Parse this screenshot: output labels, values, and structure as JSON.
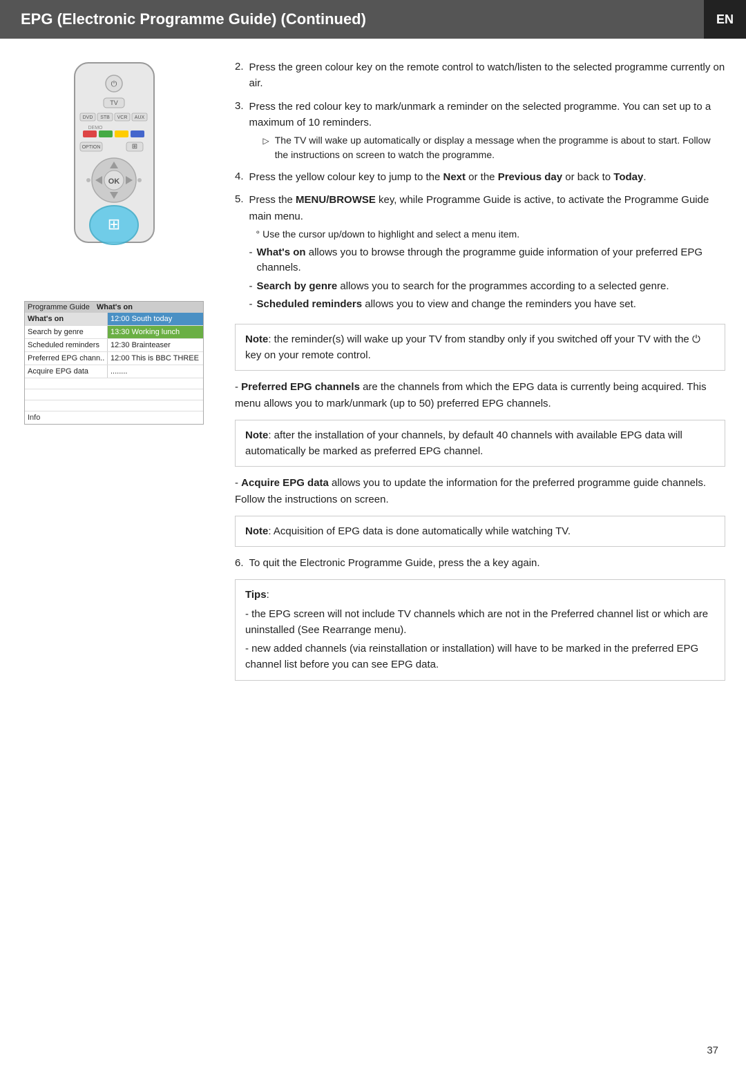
{
  "header": {
    "title": "EPG (Electronic Programme Guide) (Continued)",
    "lang": "EN"
  },
  "steps": [
    {
      "num": "2.",
      "text": "Press the green colour key on the remote control to watch/listen to the selected programme currently on air."
    },
    {
      "num": "3.",
      "text": "Press the red colour key to mark/unmark a reminder on the selected programme. You can set up to a maximum of 10 reminders.",
      "sub": "The TV will wake up automatically or display a message when the programme is about to start. Follow the instructions on screen to watch the programme."
    },
    {
      "num": "4.",
      "text_before": "Press the yellow colour key to jump to the ",
      "bold_part": "Next",
      "text_middle": " or the ",
      "bold_part2": "Previous day",
      "text_after": " or back to ",
      "bold_part3": "Today",
      "text_end": "."
    },
    {
      "num": "5.",
      "text_before": "Press the ",
      "bold_part": "MENU/BROWSE",
      "text_after": " key, while Programme Guide is active, to activate the Programme Guide main menu.",
      "degree_text": "Use the cursor up/down to highlight and select a menu item.",
      "sub_items": [
        {
          "bold": "What's on",
          "text": " allows you to browse through the programme guide information of your preferred EPG channels."
        },
        {
          "bold": "Search by genre",
          "text": " allows you to search for the programmes according to a selected genre."
        },
        {
          "bold": "Scheduled reminders",
          "text": " allows you to view and change the reminders you have set."
        }
      ]
    }
  ],
  "note1": {
    "label": "Note",
    "text": ": the reminder(s) will wake up your TV from standby only if you switched off your TV with the ",
    "text2": " key on your remote control."
  },
  "preferred_epg": {
    "bold_label": "Preferred EPG channels",
    "text": " are the channels from which the EPG data is currently being  acquired. This menu allows you to mark/unmark (up to 50) preferred EPG channels."
  },
  "note2": {
    "label": "Note",
    "text": ": after the installation of your channels, by default 40 channels with available EPG data will automatically be marked as preferred EPG channel."
  },
  "acquire_epg": {
    "bold_label": "Acquire EPG data",
    "text": " allows you to update the information for the preferred programme guide channels. Follow the instructions on screen."
  },
  "note3": {
    "label": "Note",
    "text": ": Acquisition of EPG data is done automatically while watching TV."
  },
  "step6": {
    "num": "6.",
    "text": "To quit the Electronic Programme Guide, press the a key again."
  },
  "tips": {
    "label": "Tips",
    "items": [
      "the EPG screen will not include TV channels which are not in the Preferred channel list or which are uninstalled (See Rearrange menu).",
      "new added channels (via reinstallation or installation) will have to be marked in the preferred EPG channel list before you can see EPG data."
    ]
  },
  "epg_screen": {
    "header_left": "Programme Guide",
    "header_right": "What's on",
    "rows": [
      {
        "left": "What's on",
        "right": "12:00 South today",
        "right_style": "blue-bg",
        "selected": true
      },
      {
        "left": "Search by genre",
        "right": "13:30 Working lunch",
        "right_style": "highlight"
      },
      {
        "left": "Scheduled reminders",
        "right": "12:30 Brainteaser",
        "right_style": "normal"
      },
      {
        "left": "Preferred EPG chann..",
        "right": "12:00 This is BBC THREE",
        "right_style": "normal"
      },
      {
        "left": "Acquire EPG data",
        "right": "........",
        "right_style": "normal"
      }
    ],
    "info_label": "Info"
  },
  "page_number": "37"
}
